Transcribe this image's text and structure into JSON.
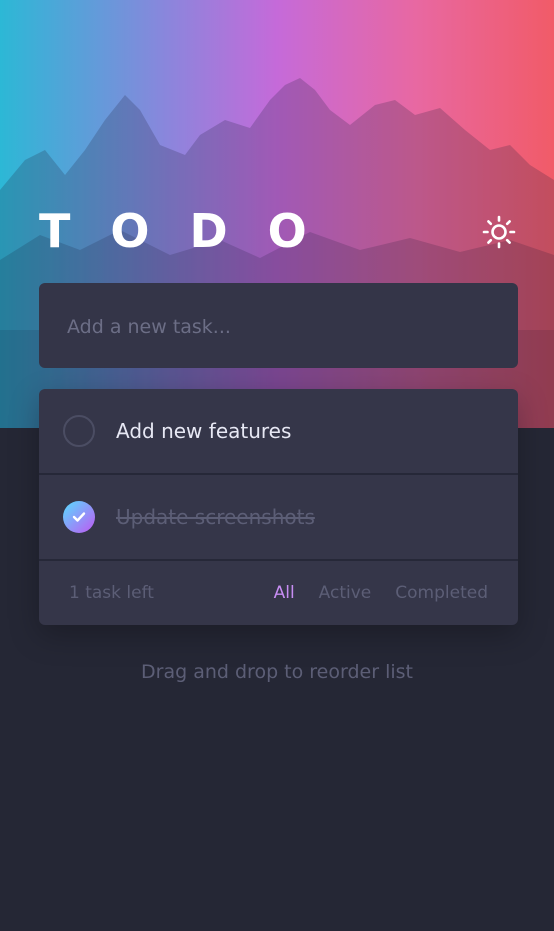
{
  "app": {
    "title": "TODO",
    "theme_icon": "sun-icon"
  },
  "new_task": {
    "placeholder": "Add a new task...",
    "value": ""
  },
  "tasks": [
    {
      "text": "Add new features",
      "completed": false
    },
    {
      "text": "Update screenshots",
      "completed": true
    }
  ],
  "footer": {
    "items_left": "1 task left",
    "filters": [
      "All",
      "Active",
      "Completed"
    ],
    "active_filter": "All"
  },
  "hint": "Drag and drop to reorder list",
  "colors": {
    "background": "#252735",
    "card": "#353649",
    "accent": "#c78df3",
    "check_gradient_start": "#57ddff",
    "check_gradient_end": "#c058f3",
    "muted_text": "#5c5e76"
  }
}
